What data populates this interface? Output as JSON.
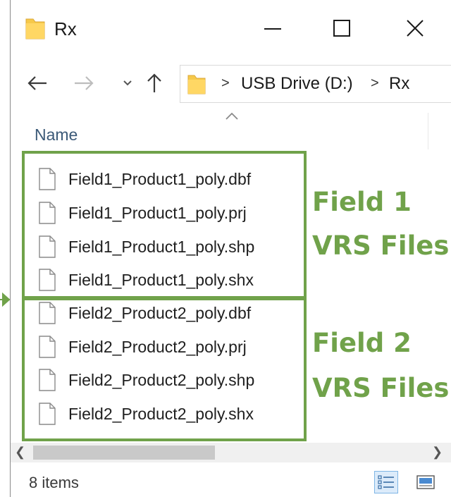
{
  "window": {
    "title": "Rx"
  },
  "nav": {
    "breadcrumb": [
      "USB Drive (D:)",
      "Rx"
    ],
    "separator": ">"
  },
  "column": {
    "name_label": "Name"
  },
  "files": [
    "Field1_Product1_poly.dbf",
    "Field1_Product1_poly.prj",
    "Field1_Product1_poly.shp",
    "Field1_Product1_poly.shx",
    "Field2_Product2_poly.dbf",
    "Field2_Product2_poly.prj",
    "Field2_Product2_poly.shp",
    "Field2_Product2_poly.shx"
  ],
  "annotations": {
    "group1_line1": "Field 1",
    "group1_line2": "VRS Files",
    "group2_line1": "Field 2",
    "group2_line2": "VRS Files"
  },
  "status": {
    "item_count": "8 items"
  },
  "colors": {
    "annotation_green": "#70a24a",
    "folder_yellow": "#f6c94a"
  },
  "icons": [
    "folder-icon",
    "minimize-icon",
    "maximize-icon",
    "close-icon",
    "back-arrow-icon",
    "forward-arrow-icon",
    "recent-locations-icon",
    "up-arrow-icon",
    "file-icon",
    "details-view-icon",
    "large-icons-view-icon"
  ]
}
